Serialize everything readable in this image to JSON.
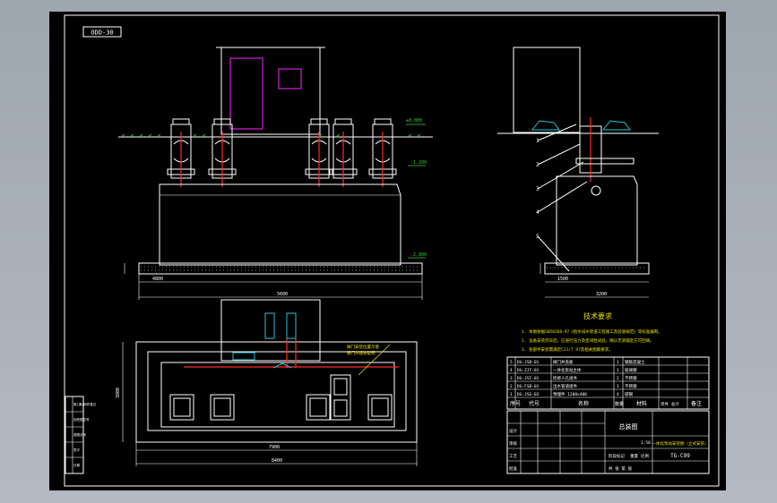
{
  "drawing": {
    "code_box": "ODD-30",
    "tech_title": "技术要求",
    "tech_notes": [
      "1. 本图依据GB50268-97《给水排水管道工程施工及验收规范》等标准编制。",
      "2. 设备安装完毕后，应进行压力及密闭性试验，确认无渗漏后方可回填。",
      "3. 各部件安装需满足CJJ/T 97及相关图集要求。"
    ],
    "part_numbers": [
      "1",
      "2",
      "3",
      "4",
      "5"
    ],
    "legend_notes": [
      "阀门安装位置示意",
      "阀门井规格说明"
    ],
    "dims": {
      "front_width": "5600",
      "front_base": "4800",
      "plan_width": "7900",
      "plan_outer": "8400",
      "plan_height": "3800",
      "side_width": "3200",
      "side_base": "1500",
      "elev_top": "±0.000",
      "elev_mid": "-1.200",
      "elev_low": "-2.800"
    }
  },
  "bom": {
    "rows": [
      {
        "no": "5",
        "code": "DG-JSB-01",
        "name": "阀门井盖板",
        "qty": "1",
        "material": "钢筋混凝土"
      },
      {
        "no": "4",
        "code": "DG-ZJF-01",
        "name": "一体化泵站主体",
        "qty": "1",
        "material": "玻璃钢"
      },
      {
        "no": "3",
        "code": "DG-JSF-01",
        "name": "检修人孔组件",
        "qty": "2",
        "material": "不锈钢"
      },
      {
        "no": "2",
        "code": "DG-FSB-01",
        "name": "出水管道组件",
        "qty": "1",
        "material": "不锈钢"
      },
      {
        "no": "1",
        "code": "DG-JSG-03",
        "name": "预埋件 1200×400",
        "qty": "4",
        "material": "碳钢"
      }
    ],
    "header": {
      "no": "序号",
      "code": "代号",
      "name": "名称",
      "qty": "数量",
      "material": "材料",
      "weight": "单件 总计",
      "note": "备注"
    }
  },
  "title_block": {
    "assembly_label": "总装图",
    "drawing_title": "一体化泵站安装图（立式安装）",
    "drawing_no": "TG-C99",
    "fields": [
      "设计",
      "审核",
      "工艺",
      "标准化",
      "批准"
    ],
    "stage_label": "阶段标记",
    "weight_label": "重量",
    "scale_label": "比例",
    "scale_value": "1:50",
    "sheet_label": "共 张 第 张"
  },
  "left_block": [
    "借(通)用件登记",
    "旧底图总号",
    "底图总号",
    "签字",
    "日期"
  ]
}
